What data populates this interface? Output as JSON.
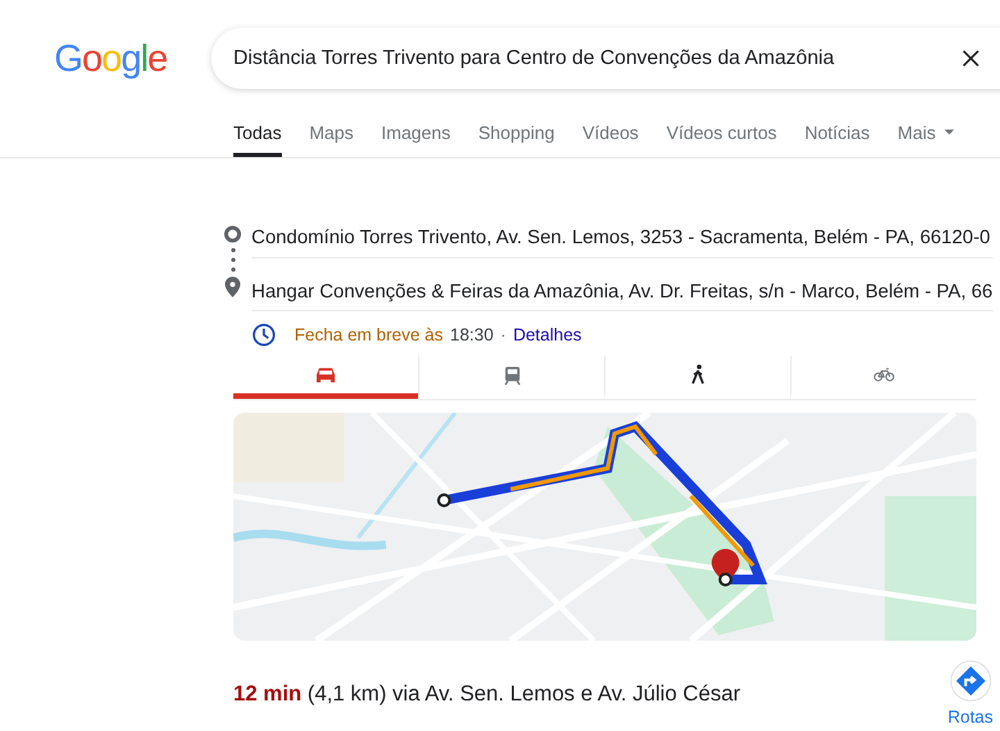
{
  "logo": "Google",
  "search": {
    "value": "Distância Torres Trivento para Centro de Convenções da Amazônia"
  },
  "tabs": [
    {
      "label": "Todas",
      "selected": true
    },
    {
      "label": "Maps",
      "selected": false
    },
    {
      "label": "Imagens",
      "selected": false
    },
    {
      "label": "Shopping",
      "selected": false
    },
    {
      "label": "Vídeos",
      "selected": false
    },
    {
      "label": "Vídeos curtos",
      "selected": false
    },
    {
      "label": "Notícias",
      "selected": false
    },
    {
      "label": "Mais",
      "selected": false,
      "kind": "menu"
    }
  ],
  "directions": {
    "origin": "Condomínio Torres Trivento, Av. Sen. Lemos, 3253 - Sacramenta, Belém - PA, 66120-0",
    "destination": "Hangar Convenções & Feiras da Amazônia, Av. Dr. Freitas, s/n - Marco, Belém - PA, 66",
    "hours_status": "Fecha em breve às",
    "hours_time": "18:30",
    "hours_separator": "·",
    "details_link": "Detalhes",
    "modes": [
      {
        "kind": "car",
        "selected": true
      },
      {
        "kind": "transit",
        "selected": false
      },
      {
        "kind": "walk",
        "selected": false
      },
      {
        "kind": "bike",
        "selected": false
      }
    ],
    "duration": "12 min",
    "summary": "(4,1 km) via Av. Sen. Lemos e Av. Júlio César",
    "routes_button": "Rotas"
  }
}
